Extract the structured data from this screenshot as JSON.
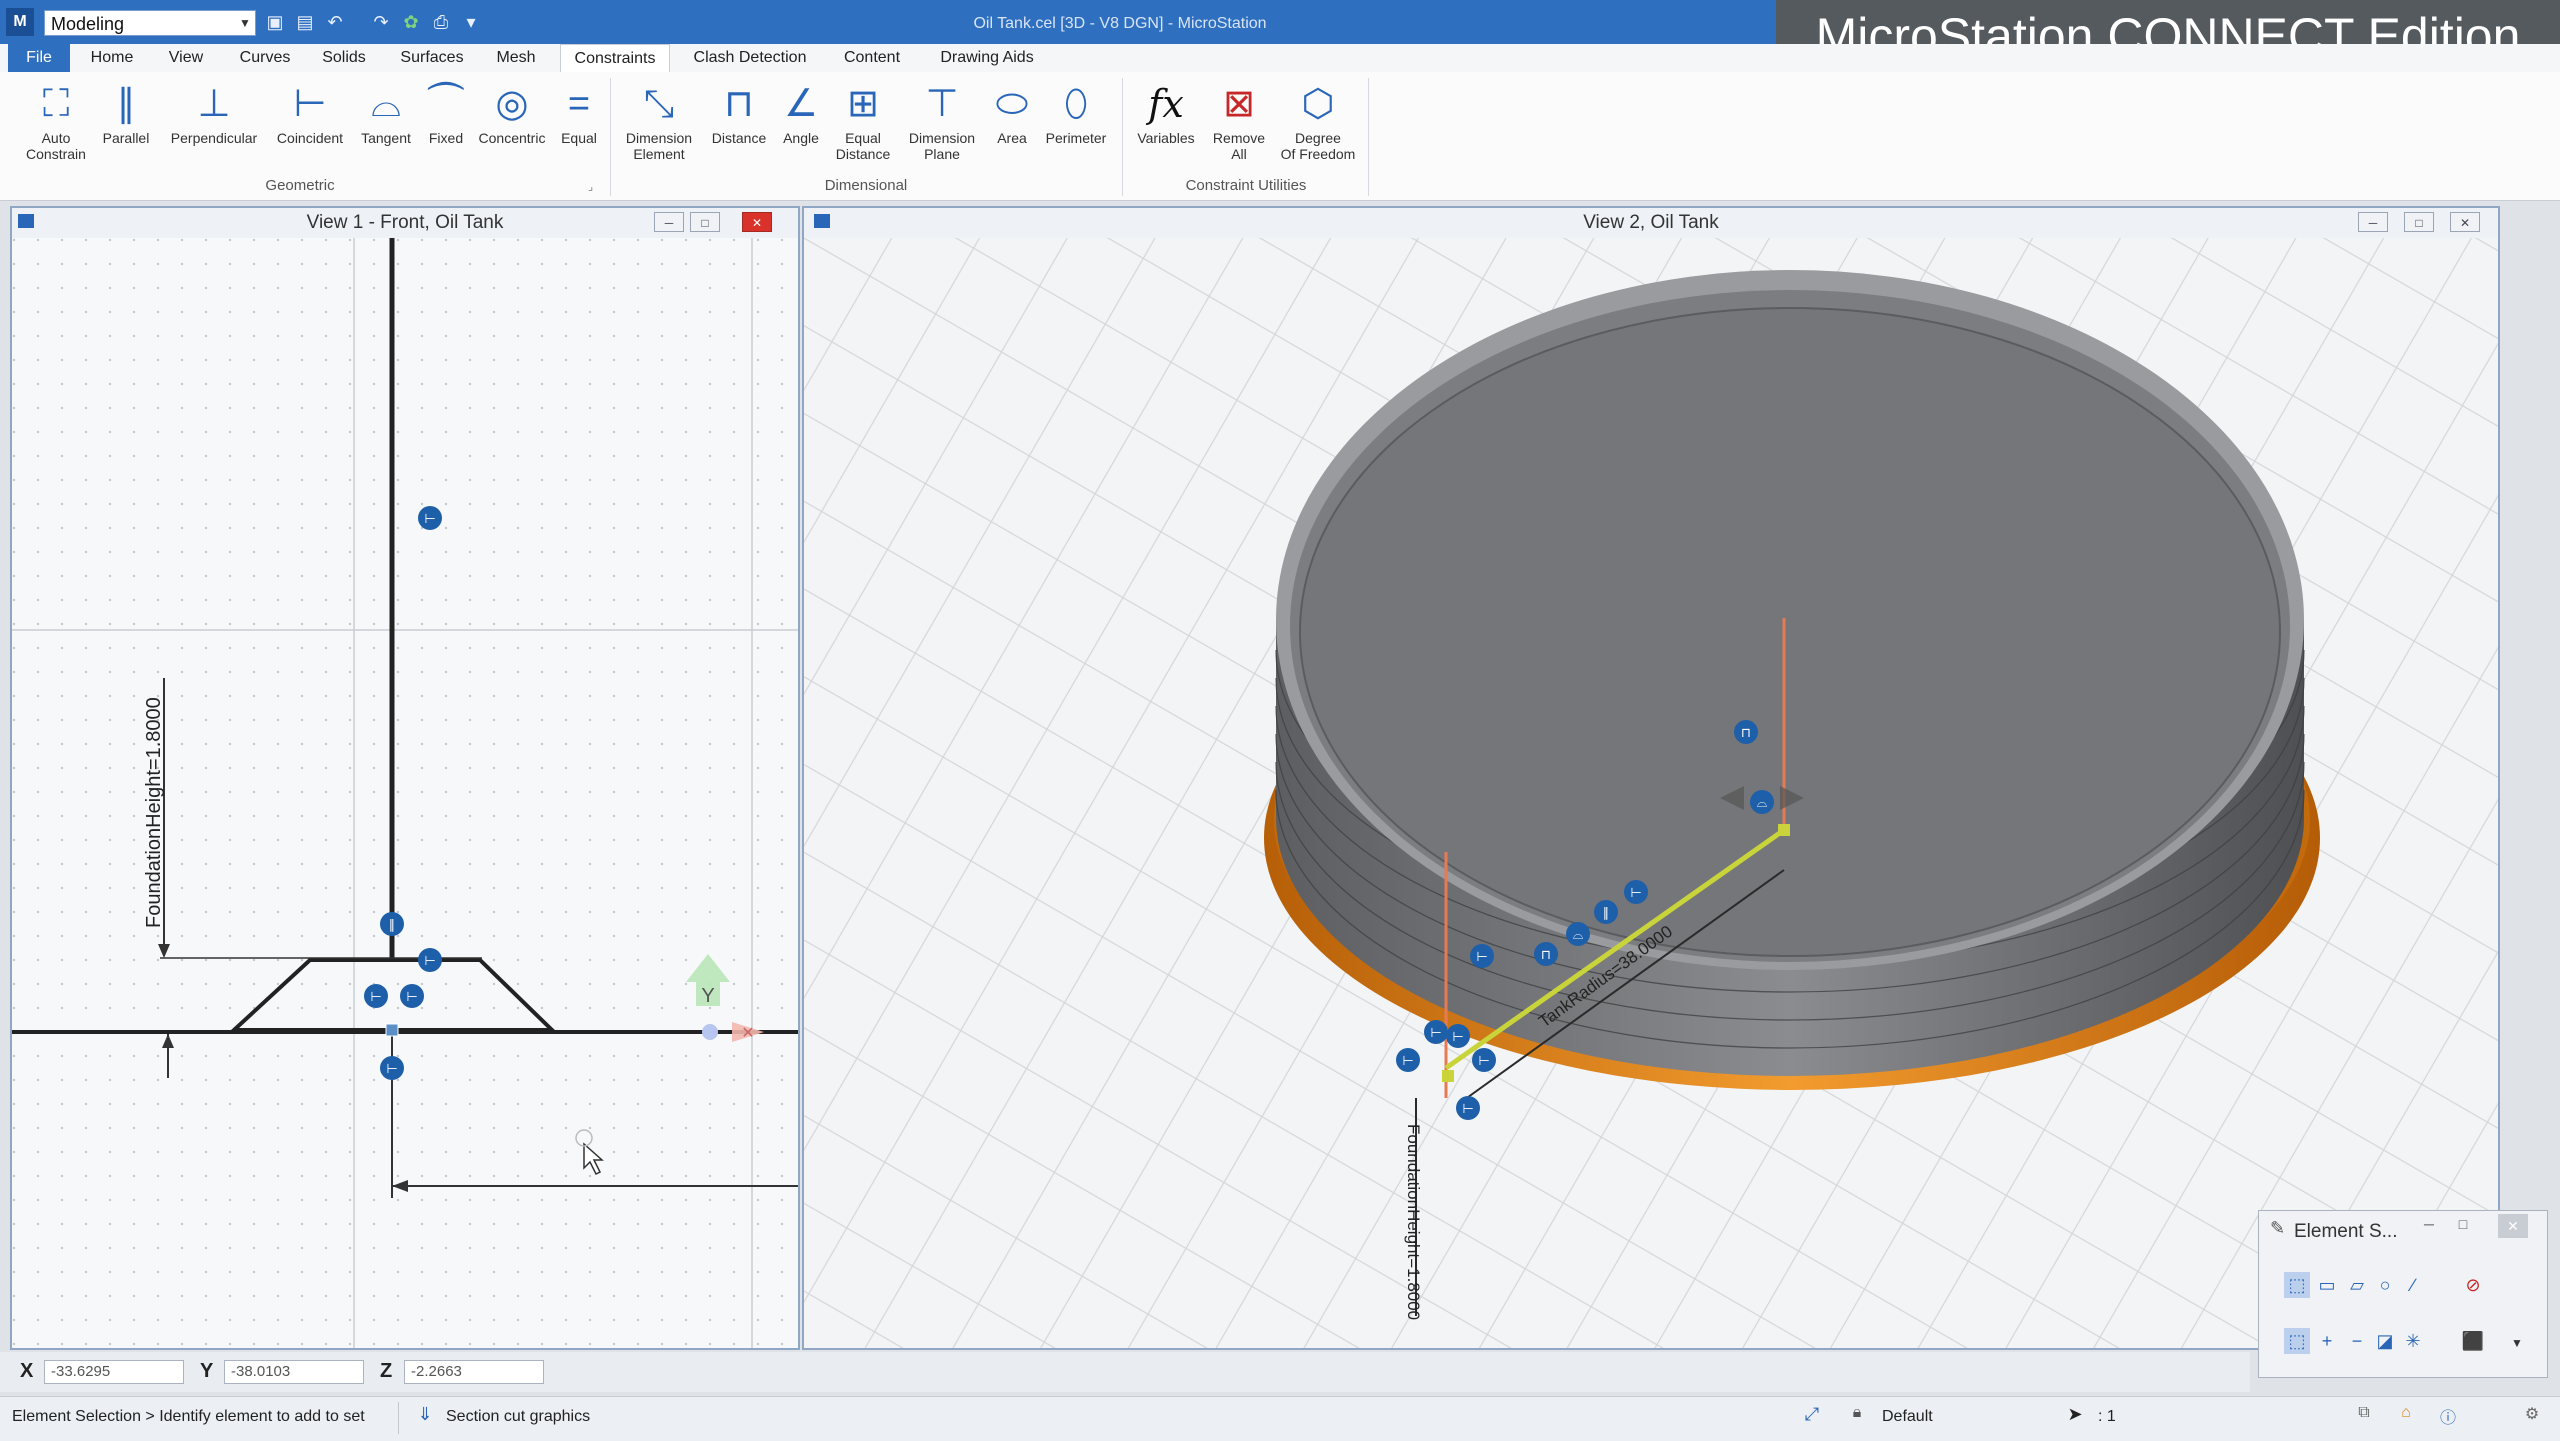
{
  "app": {
    "window_title": "Oil Tank.cel [3D - V8 DGN] - MicroStation",
    "brand_banner": "MicroStation CONNECT Edition",
    "workspace_selector": "Modeling"
  },
  "quick_access": [
    "save-icon",
    "save-settings-icon",
    "undo-icon",
    "redo-icon",
    "green-icon",
    "print-icon",
    "customize-icon"
  ],
  "menu": {
    "file": "File",
    "items": [
      "Home",
      "View",
      "Curves",
      "Solids",
      "Surfaces",
      "Mesh",
      "Constraints",
      "Clash Detection",
      "Content",
      "Drawing Aids"
    ],
    "active": "Constraints"
  },
  "ribbon": {
    "geometric": {
      "label": "Geometric",
      "buttons": [
        {
          "label": "Auto\nConstrain",
          "icon": "auto-constrain-icon"
        },
        {
          "label": "Parallel",
          "icon": "parallel-icon"
        },
        {
          "label": "Perpendicular",
          "icon": "perpendicular-icon"
        },
        {
          "label": "Coincident",
          "icon": "coincident-icon"
        },
        {
          "label": "Tangent",
          "icon": "tangent-icon"
        },
        {
          "label": "Fixed",
          "icon": "fixed-icon"
        },
        {
          "label": "Concentric",
          "icon": "concentric-icon"
        },
        {
          "label": "Equal",
          "icon": "equal-icon"
        }
      ]
    },
    "dimensional": {
      "label": "Dimensional",
      "buttons": [
        {
          "label": "Dimension\nElement",
          "icon": "dimension-element-icon"
        },
        {
          "label": "Distance",
          "icon": "distance-icon"
        },
        {
          "label": "Angle",
          "icon": "angle-icon"
        },
        {
          "label": "Equal\nDistance",
          "icon": "equal-distance-icon"
        },
        {
          "label": "Dimension\nPlane",
          "icon": "dimension-plane-icon"
        },
        {
          "label": "Area",
          "icon": "area-icon"
        },
        {
          "label": "Perimeter",
          "icon": "perimeter-icon"
        }
      ]
    },
    "utilities": {
      "label": "Constraint Utilities",
      "buttons": [
        {
          "label": "Variables",
          "icon": "fx-icon"
        },
        {
          "label": "Remove\nAll",
          "icon": "remove-all-icon"
        },
        {
          "label": "Degree\nOf Freedom",
          "icon": "degree-of-freedom-icon"
        }
      ]
    }
  },
  "view1": {
    "title": "View 1 - Front, Oil Tank",
    "dimension_text": "FoundationHeight=1.8000",
    "y_axis": "Y"
  },
  "view2": {
    "title": "View 2, Oil Tank",
    "radius_text": "TankRadius=38.0000",
    "height_text": "FoundationHeight=1.8000"
  },
  "coords": {
    "x_label": "X",
    "x_value": "-33.6295",
    "y_label": "Y",
    "y_value": "-38.0103",
    "z_label": "Z",
    "z_value": "-2.2663"
  },
  "status": {
    "prompt": "Element Selection > Identify element to add to set",
    "section": "Section cut graphics",
    "level": "Default",
    "scale": ": 1"
  },
  "element_selection": {
    "title": "Element S..."
  },
  "colors": {
    "title_bar": "#2e6fbf",
    "accent": "#2a66b8",
    "foundation": "#e07b12",
    "tank": "#7c7d80",
    "handle": "#1d5fa8",
    "guide_line": "#c8d43a"
  }
}
